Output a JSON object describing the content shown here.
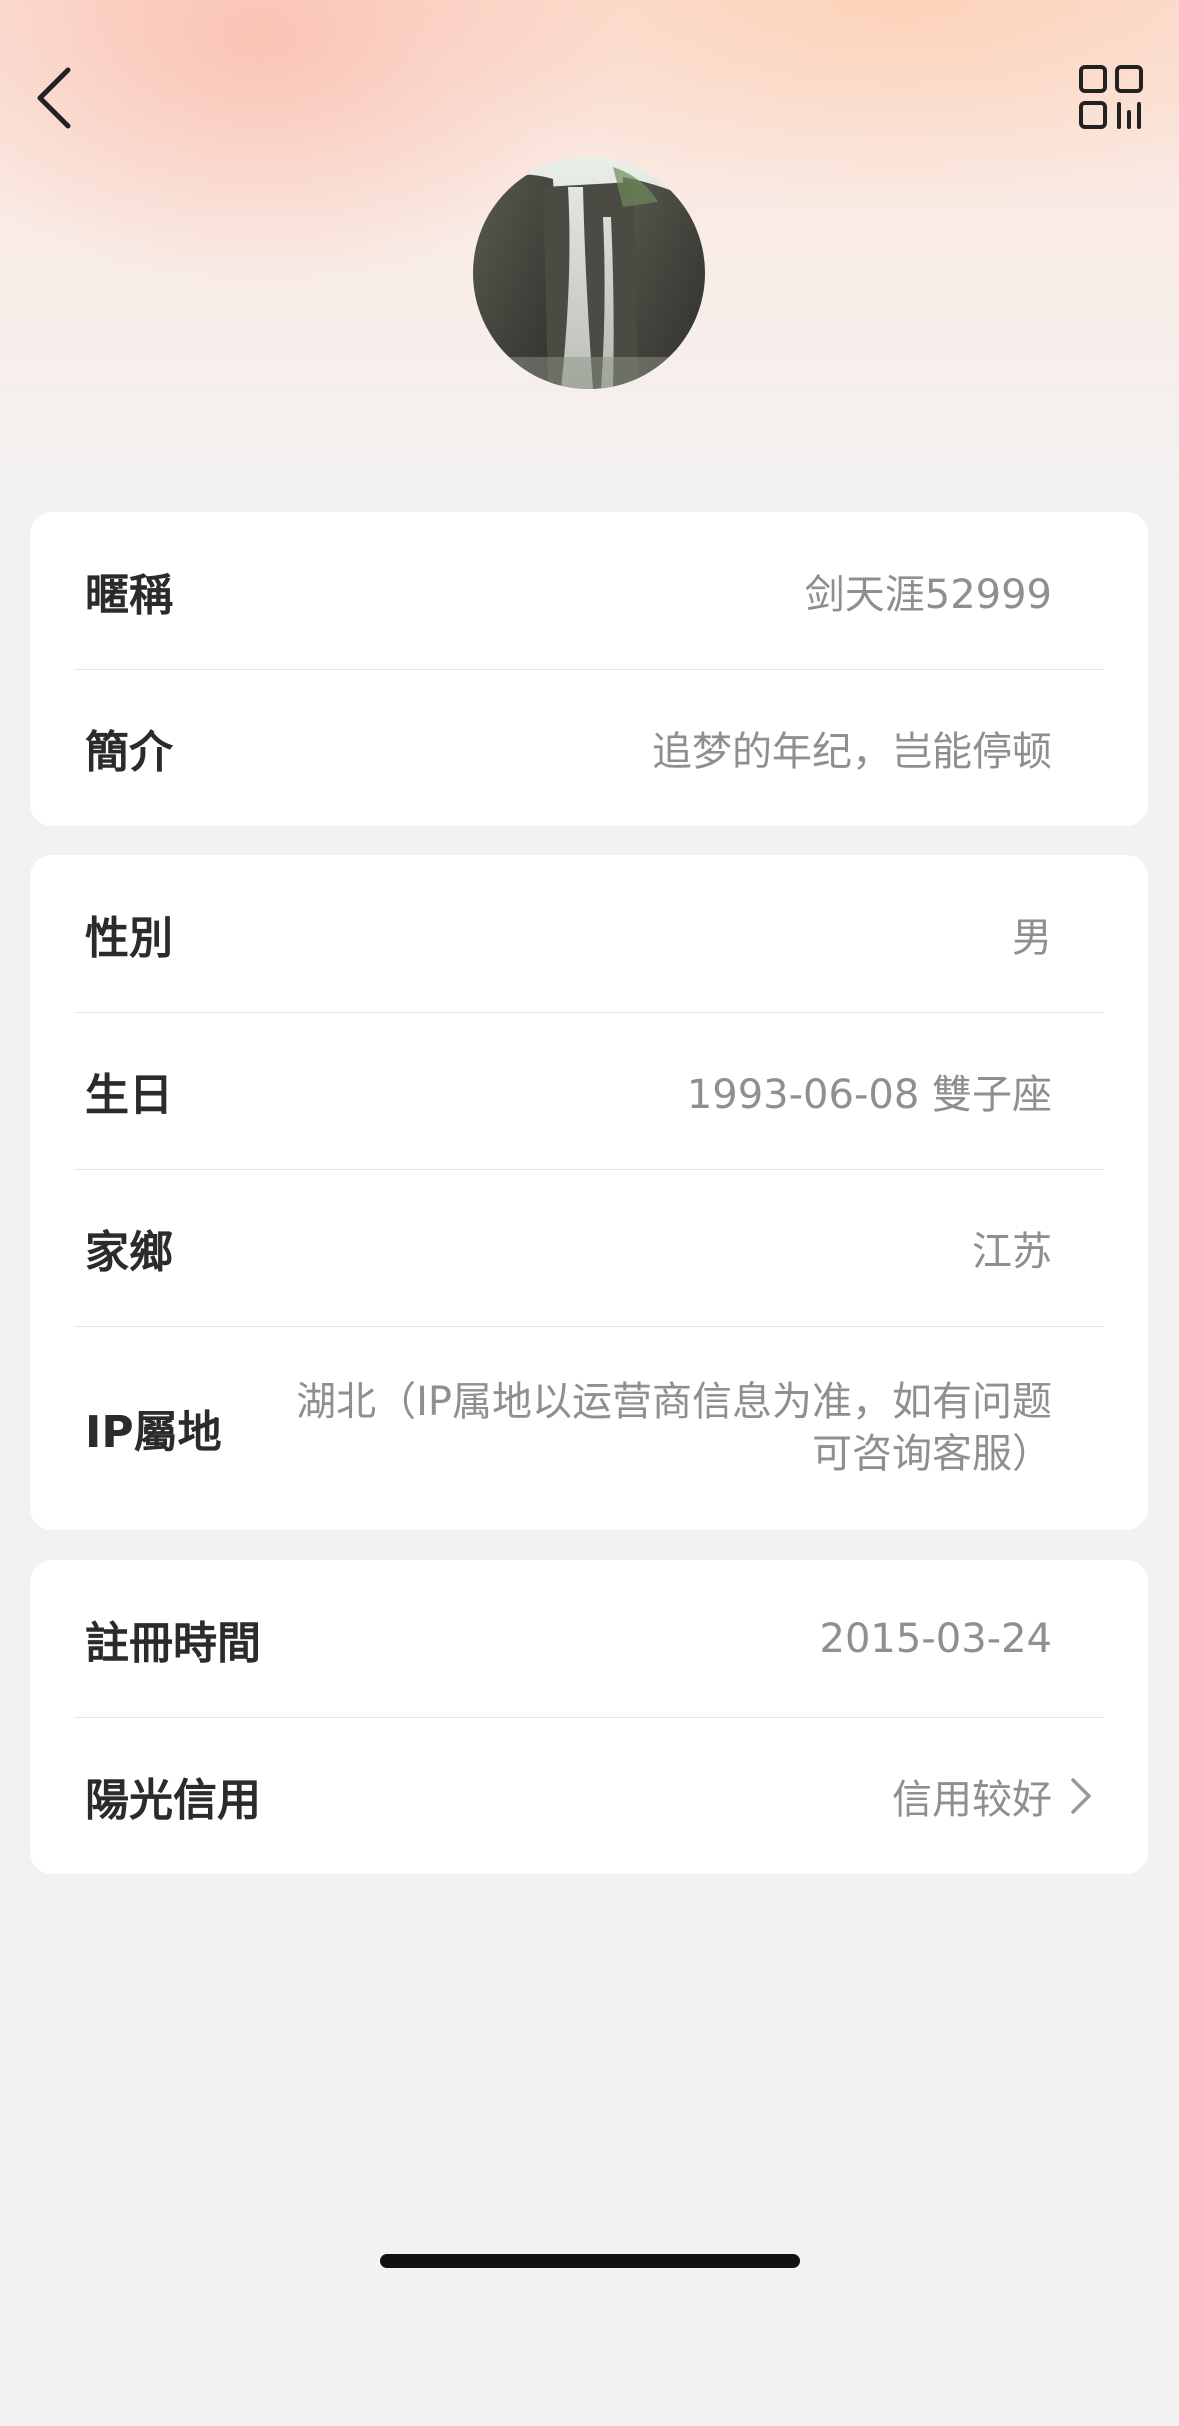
{
  "header": {
    "back_icon": "chevron-left-icon",
    "qr_icon": "qr-code-icon",
    "avatar_alt": "waterfall-photo"
  },
  "profile": {
    "nickname_label": "暱稱",
    "nickname_value": "剑天涯52999",
    "bio_label": "簡介",
    "bio_value": "追梦的年纪，岂能停顿"
  },
  "personal": {
    "gender_label": "性別",
    "gender_value": "男",
    "birthday_label": "生日",
    "birthday_value": "1993-06-08 雙子座",
    "hometown_label": "家鄉",
    "hometown_value": "江苏",
    "ip_label": "IP屬地",
    "ip_value": "湖北（IP属地以运营商信息为准，如有问题可咨询客服）"
  },
  "account": {
    "register_label": "註冊時間",
    "register_value": "2015-03-24",
    "credit_label": "陽光信用",
    "credit_value": "信用较好",
    "credit_icon": "chevron-right-icon"
  },
  "colors": {
    "label": "#2b2b2b",
    "value": "#8f8f8f",
    "background": "#f2f2f2",
    "card": "#ffffff"
  }
}
